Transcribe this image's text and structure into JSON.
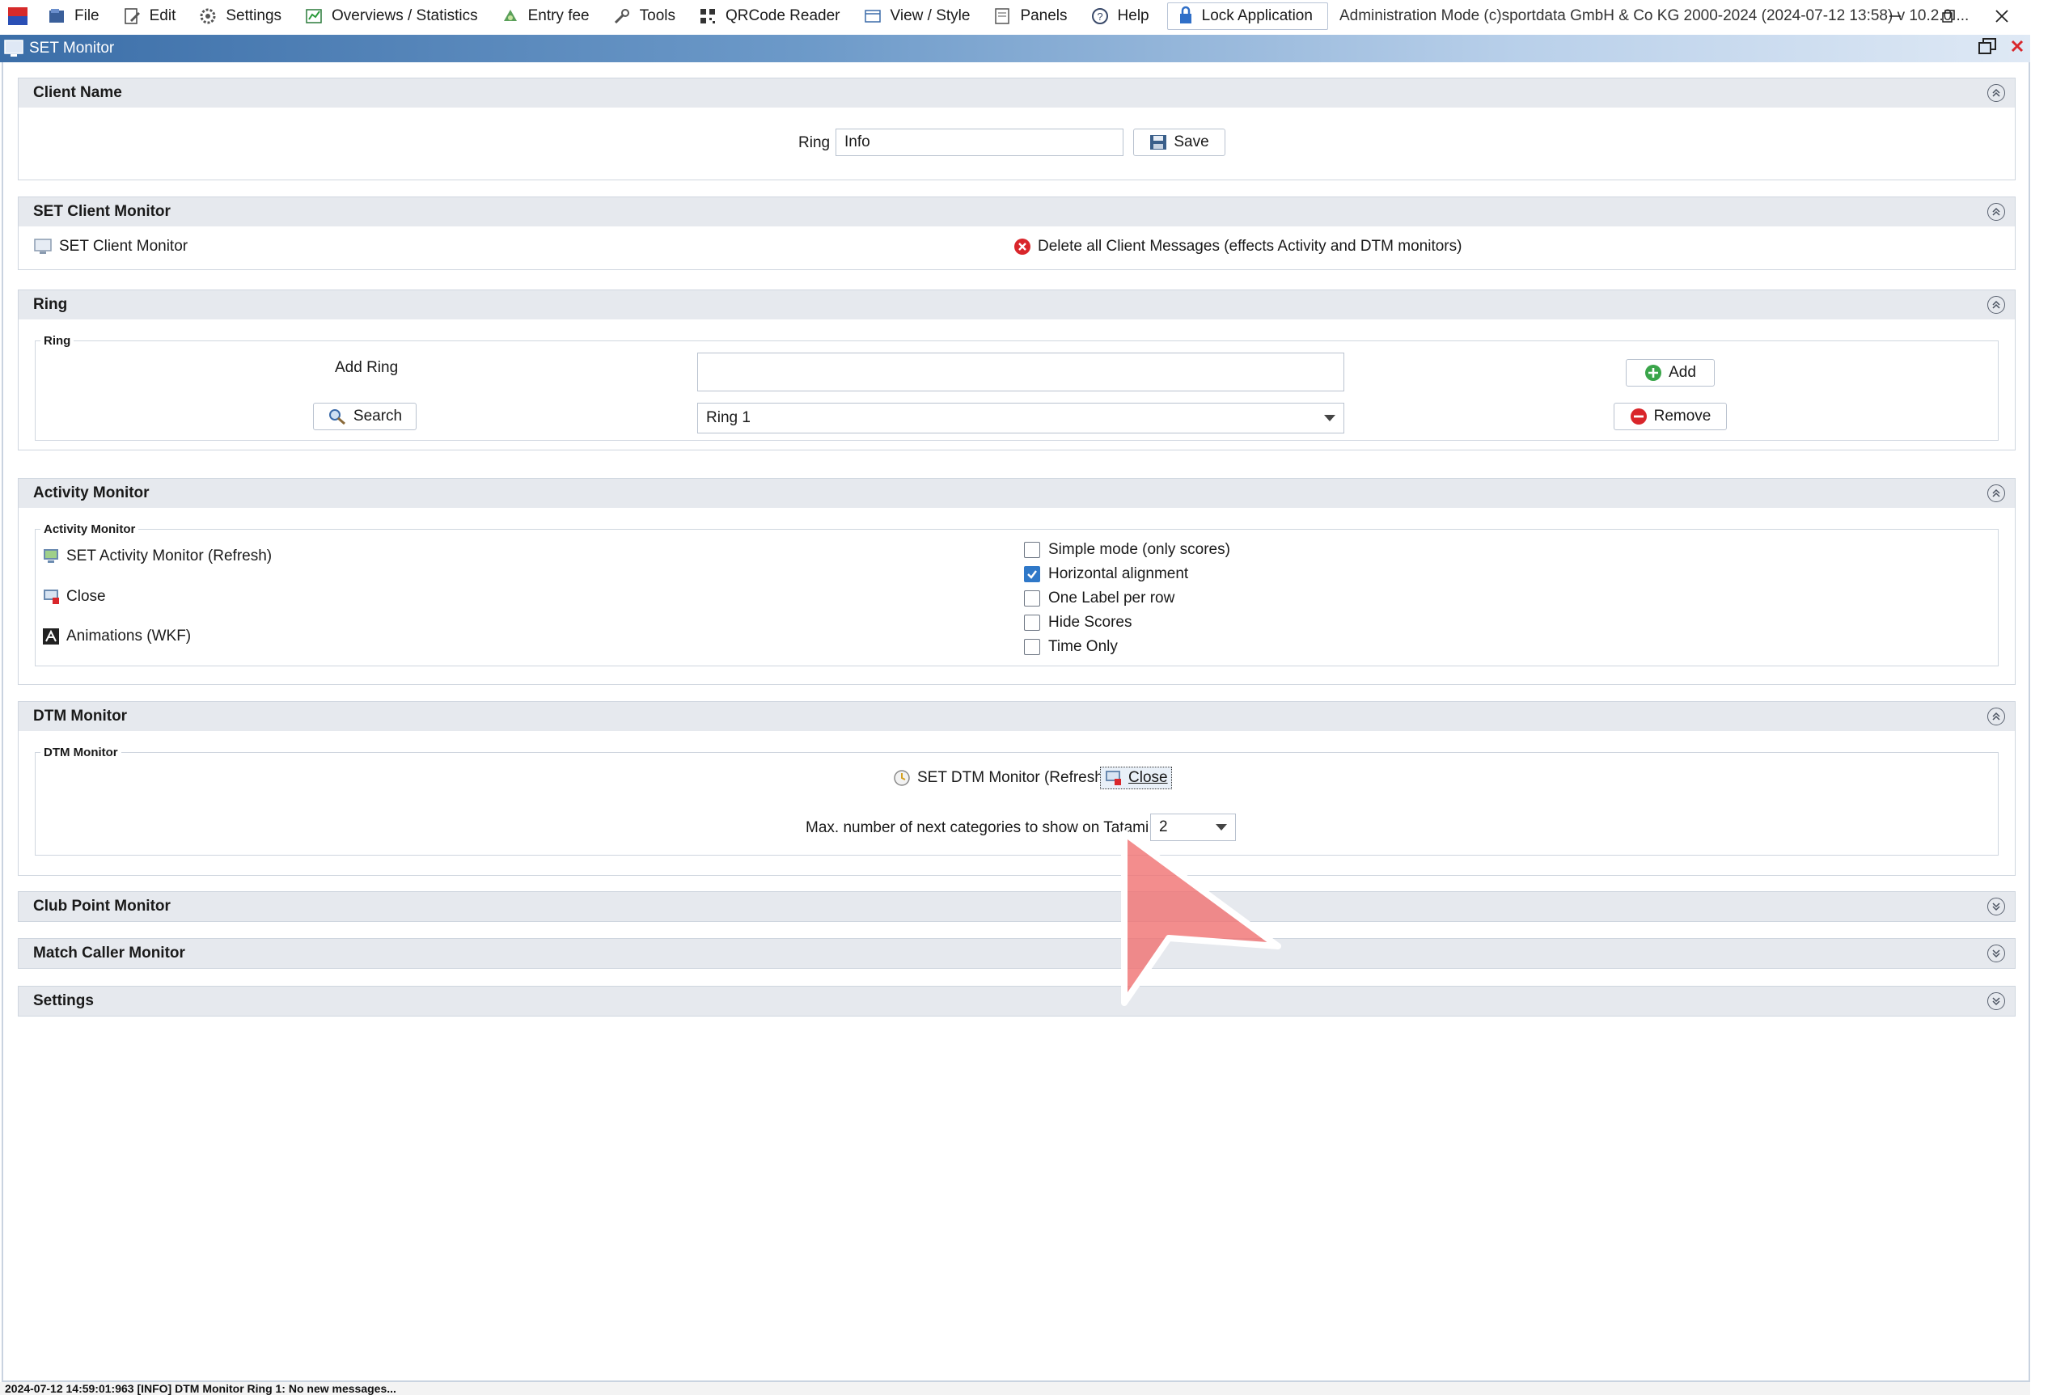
{
  "menubar": {
    "items": [
      {
        "label": "File",
        "icon": "file-icon"
      },
      {
        "label": "Edit",
        "icon": "edit-icon"
      },
      {
        "label": "Settings",
        "icon": "gear-icon"
      },
      {
        "label": "Overviews / Statistics",
        "icon": "statistics-icon"
      },
      {
        "label": "Entry fee",
        "icon": "money-icon"
      },
      {
        "label": "Tools",
        "icon": "wrench-icon"
      },
      {
        "label": "QRCode Reader",
        "icon": "qrcode-icon"
      },
      {
        "label": "View / Style",
        "icon": "view-icon"
      },
      {
        "label": "Panels",
        "icon": "panels-icon"
      },
      {
        "label": "Help",
        "icon": "help-icon"
      }
    ],
    "lock_label": "Lock Application",
    "admin_text": "Administration Mode (c)sportdata GmbH & Co KG 2000-2024 (2024-07-12 13:58)  v 10.2.0 ..."
  },
  "window": {
    "title": "SET Monitor"
  },
  "client_name": {
    "header": "Client Name",
    "ring_label": "Ring",
    "ring_value": "Info",
    "save_label": "Save"
  },
  "set_client_monitor": {
    "header": "SET Client Monitor",
    "link_label": "SET Client Monitor",
    "delete_label": "Delete all Client Messages (effects Activity and DTM monitors)"
  },
  "ring": {
    "header": "Ring",
    "legend": "Ring",
    "add_ring_label": "Add Ring",
    "add_ring_value": "",
    "add_label": "Add",
    "search_label": "Search",
    "selected_ring": "Ring 1",
    "remove_label": "Remove"
  },
  "activity_monitor": {
    "header": "Activity Monitor",
    "legend": "Activity Monitor",
    "refresh_label": "SET Activity Monitor (Refresh)",
    "close_label": "Close",
    "animations_label": "Animations (WKF)",
    "options": [
      {
        "label": "Simple mode (only scores)",
        "checked": false
      },
      {
        "label": "Horizontal alignment",
        "checked": true
      },
      {
        "label": "One Label per row",
        "checked": false
      },
      {
        "label": "Hide Scores",
        "checked": false
      },
      {
        "label": "Time Only",
        "checked": false
      }
    ]
  },
  "dtm_monitor": {
    "header": "DTM Monitor",
    "legend": "DTM Monitor",
    "refresh_label": "SET DTM Monitor (Refresh)",
    "close_label": "Close",
    "max_categories_label": "Max. number of next categories to show on Tatami:",
    "max_categories_value": "2"
  },
  "collapsed_sections": {
    "club_point": "Club Point Monitor",
    "match_caller": "Match Caller Monitor",
    "settings": "Settings"
  },
  "status": {
    "message": "2024-07-12 14:59:01:963 [INFO] DTM Monitor Ring 1: No new messages..."
  },
  "colors": {
    "accent": "#2f78c8",
    "title_bar": "#3b6ea8",
    "header_bg": "#e6e9ee",
    "delete_red": "#d9262b",
    "add_green": "#3aa54a"
  }
}
